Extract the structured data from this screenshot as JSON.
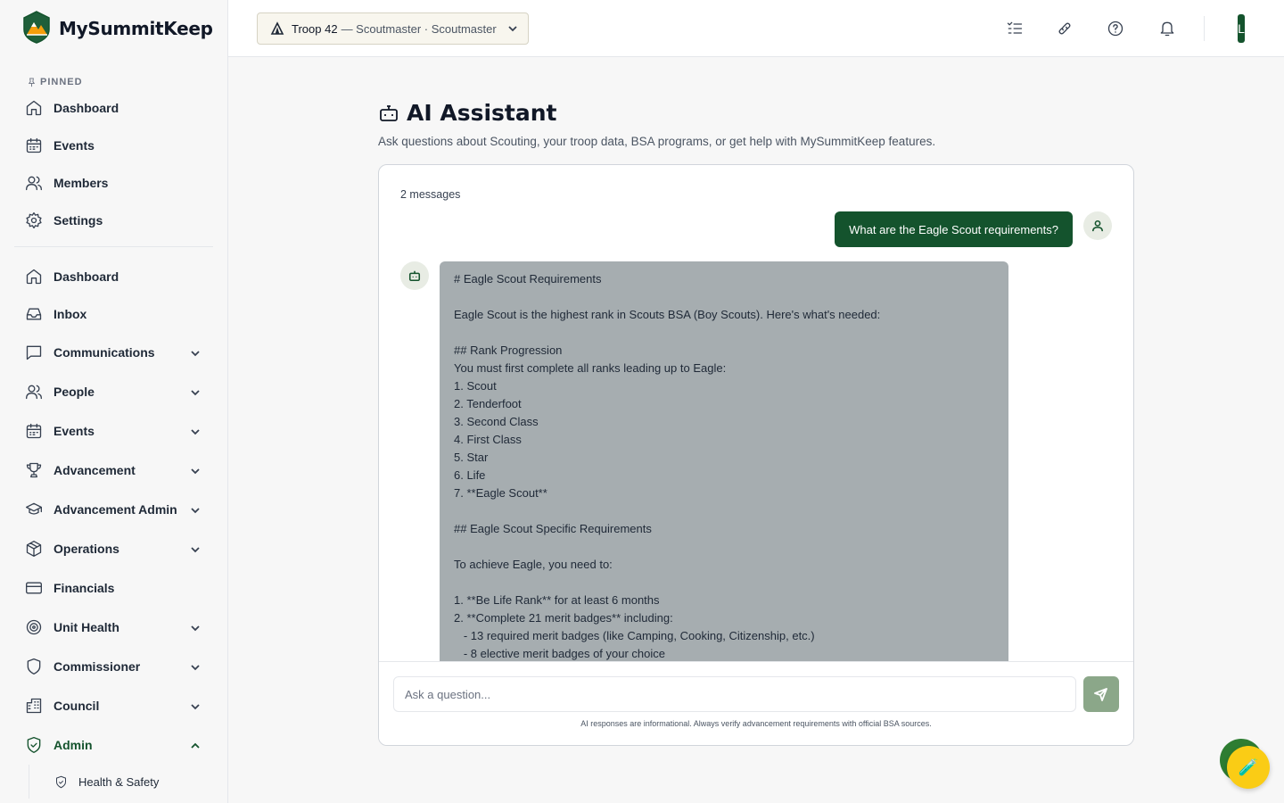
{
  "brand": {
    "name": "MySummitKeep"
  },
  "sidebar": {
    "pinned_label": "PINNED",
    "pinned": [
      {
        "label": "Dashboard",
        "icon": "home-icon"
      },
      {
        "label": "Events",
        "icon": "calendar-icon"
      },
      {
        "label": "Members",
        "icon": "users-icon"
      },
      {
        "label": "Settings",
        "icon": "gear-icon"
      }
    ],
    "items": [
      {
        "label": "Dashboard",
        "icon": "home-icon"
      },
      {
        "label": "Inbox",
        "icon": "inbox-icon"
      },
      {
        "label": "Communications",
        "icon": "message-square-icon"
      },
      {
        "label": "People",
        "icon": "users-icon"
      },
      {
        "label": "Events",
        "icon": "calendar-icon"
      },
      {
        "label": "Advancement",
        "icon": "trophy-icon"
      },
      {
        "label": "Advancement Admin",
        "icon": "graduation-cap-icon"
      },
      {
        "label": "Operations",
        "icon": "package-icon"
      },
      {
        "label": "Financials",
        "icon": "credit-card-icon"
      },
      {
        "label": "Unit Health",
        "icon": "target-icon"
      },
      {
        "label": "Commissioner",
        "icon": "shield-icon"
      },
      {
        "label": "Council",
        "icon": "building-icon"
      },
      {
        "label": "Admin",
        "icon": "shield-check-icon"
      }
    ],
    "admin_sub": {
      "label": "Health & Safety",
      "icon": "shield-check-icon"
    }
  },
  "topbar": {
    "troop_name": "Troop 42",
    "troop_role": "— Scoutmaster · Scoutmaster",
    "avatar_initial": "L"
  },
  "page": {
    "title": "AI Assistant",
    "subtitle": "Ask questions about Scouting, your troop data, BSA programs, or get help with MySummitKeep features."
  },
  "chat": {
    "message_count": "2 messages",
    "user_message": "What are the Eagle Scout requirements?",
    "assistant_lines": [
      "# Eagle Scout Requirements",
      "",
      "Eagle Scout is the highest rank in Scouts BSA (Boy Scouts). Here's what's needed:",
      "",
      "## Rank Progression",
      "You must first complete all ranks leading up to Eagle:",
      "1. Scout",
      "2. Tenderfoot",
      "3. Second Class",
      "4. First Class",
      "5. Star",
      "6. Life",
      "7. **Eagle Scout**",
      "",
      "## Eagle Scout Specific Requirements",
      "",
      "To achieve Eagle, you need to:",
      "",
      "1. **Be Life Rank** for at least 6 months",
      "2. **Complete 21 merit badges** including:",
      "   - 13 required merit badges (like Camping, Cooking, Citizenship, etc.)",
      "   - 8 elective merit badges of your choice"
    ],
    "input_placeholder": "Ask a question...",
    "disclaimer": "AI responses are informational. Always verify advancement requirements with official BSA sources."
  },
  "colors": {
    "brand_green": "#14532d",
    "assistant_bubble": "#a6adb0",
    "send_button": "#8ba789",
    "fab_yellow": "#facc15"
  }
}
